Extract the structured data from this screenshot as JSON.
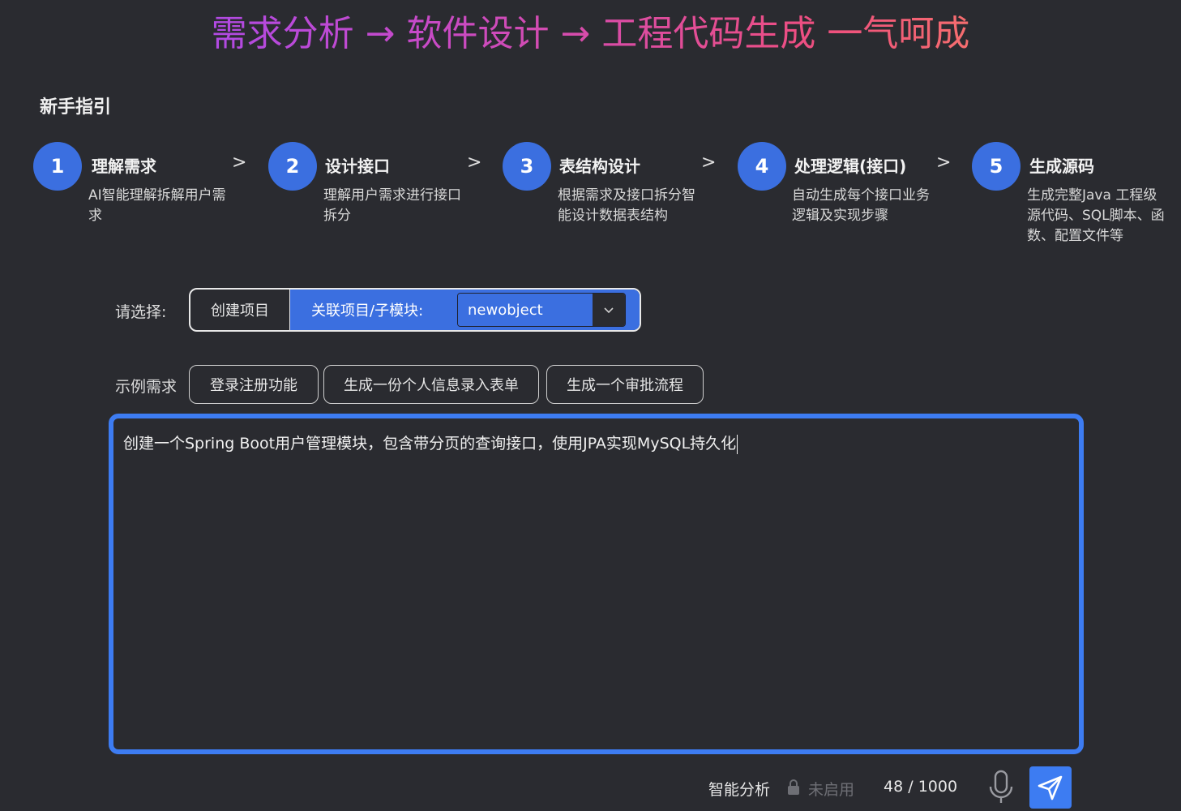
{
  "hero": {
    "title": "需求分析 → 软件设计 → 工程代码生成 一气呵成"
  },
  "guide": {
    "title": "新手指引",
    "steps": [
      {
        "number": "1",
        "title": "理解需求",
        "desc": "AI智能理解拆解用户需求"
      },
      {
        "number": "2",
        "title": "设计接口",
        "desc": "理解用户需求进行接口拆分"
      },
      {
        "number": "3",
        "title": "表结构设计",
        "desc": "根据需求及接口拆分智能设计数据表结构"
      },
      {
        "number": "4",
        "title": "处理逻辑(接口)",
        "desc": "自动生成每个接口业务逻辑及实现步骤"
      },
      {
        "number": "5",
        "title": "生成源码",
        "desc": "生成完整Java 工程级源代码、SQL脚本、函数、配置文件等"
      }
    ],
    "arrow": ">"
  },
  "selector": {
    "label": "请选择:",
    "create_label": "创建项目",
    "assoc_label": "关联项目/子模块:",
    "project_value": "newobject"
  },
  "examples": {
    "label": "示例需求",
    "items": [
      "登录注册功能",
      "生成一份个人信息录入表单",
      "生成一个审批流程"
    ]
  },
  "editor": {
    "text": "创建一个Spring Boot用户管理模块，包含带分页的查询接口，使用JPA实现MySQL持久化"
  },
  "footer": {
    "analysis_label": "智能分析",
    "analysis_status": "未启用",
    "count": "48",
    "separator": "/",
    "max": "1000"
  },
  "colors": {
    "accent": "#3b6fe0",
    "editor_border": "#3d7cf2",
    "background": "#2a2b30"
  },
  "icons": {
    "lock": "lock-icon",
    "caret": "chevron-down-icon",
    "mic": "microphone-icon",
    "send": "send-icon"
  }
}
